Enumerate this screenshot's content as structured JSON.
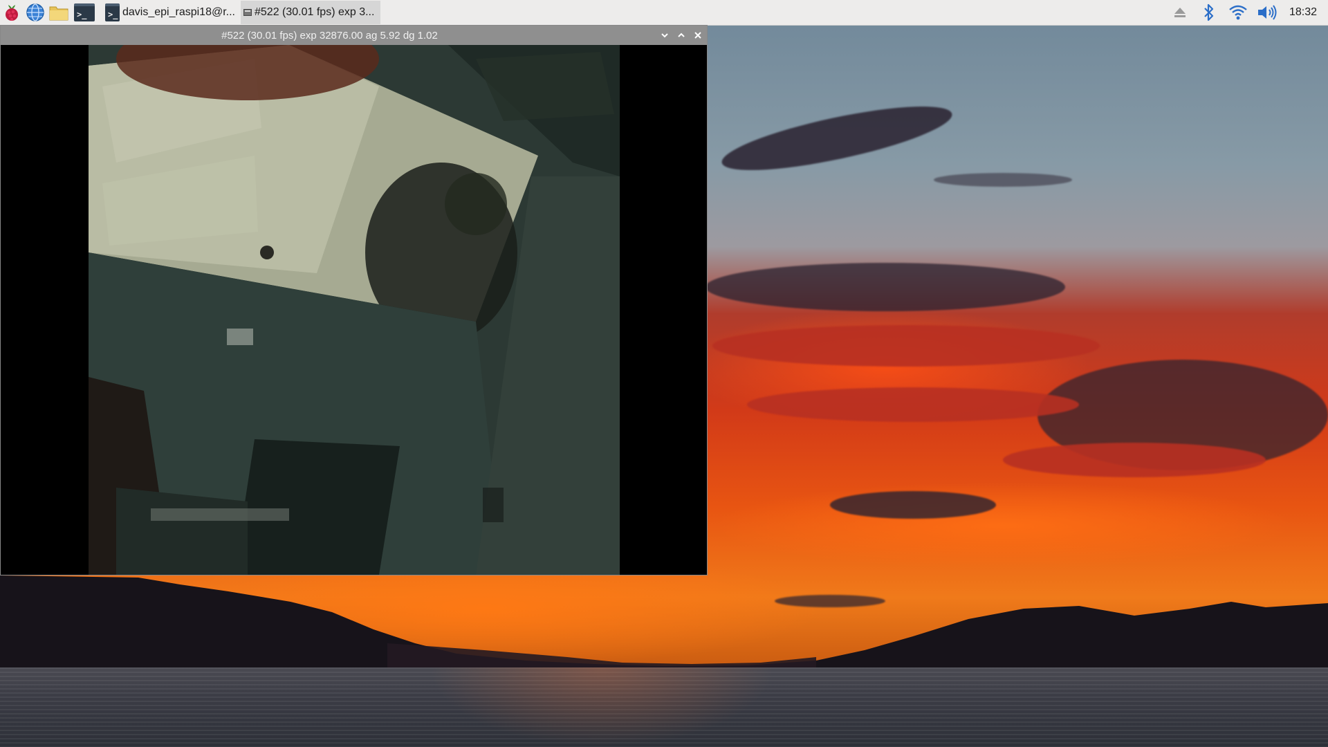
{
  "taskbar": {
    "launchers": [
      {
        "icon": "raspberry-menu-icon"
      },
      {
        "icon": "web-browser-globe-icon"
      },
      {
        "icon": "file-manager-folder-icon"
      },
      {
        "icon": "terminal-icon",
        "glyph": ">_"
      }
    ],
    "tasks": [
      {
        "icon": "terminal-icon",
        "glyph": ">_",
        "label": "davis_epi_raspi18@r...",
        "active": false
      },
      {
        "icon": "video-window-icon",
        "label": "#522 (30.01 fps) exp 3...",
        "active": true
      }
    ],
    "tray": {
      "icons": [
        "eject-icon",
        "bluetooth-icon",
        "wifi-icon",
        "volume-icon"
      ],
      "clock": "18:32"
    }
  },
  "preview_window": {
    "title": "#522 (30.01 fps) exp 32876.00 ag 5.92 dg 1.02",
    "buttons": [
      "minimize-icon",
      "maximize-icon",
      "close-icon"
    ]
  },
  "colors": {
    "taskbar_bg": "#edeceb",
    "titlebar_bg": "#8f8f8f",
    "accent_blue": "#2b6ec8"
  }
}
